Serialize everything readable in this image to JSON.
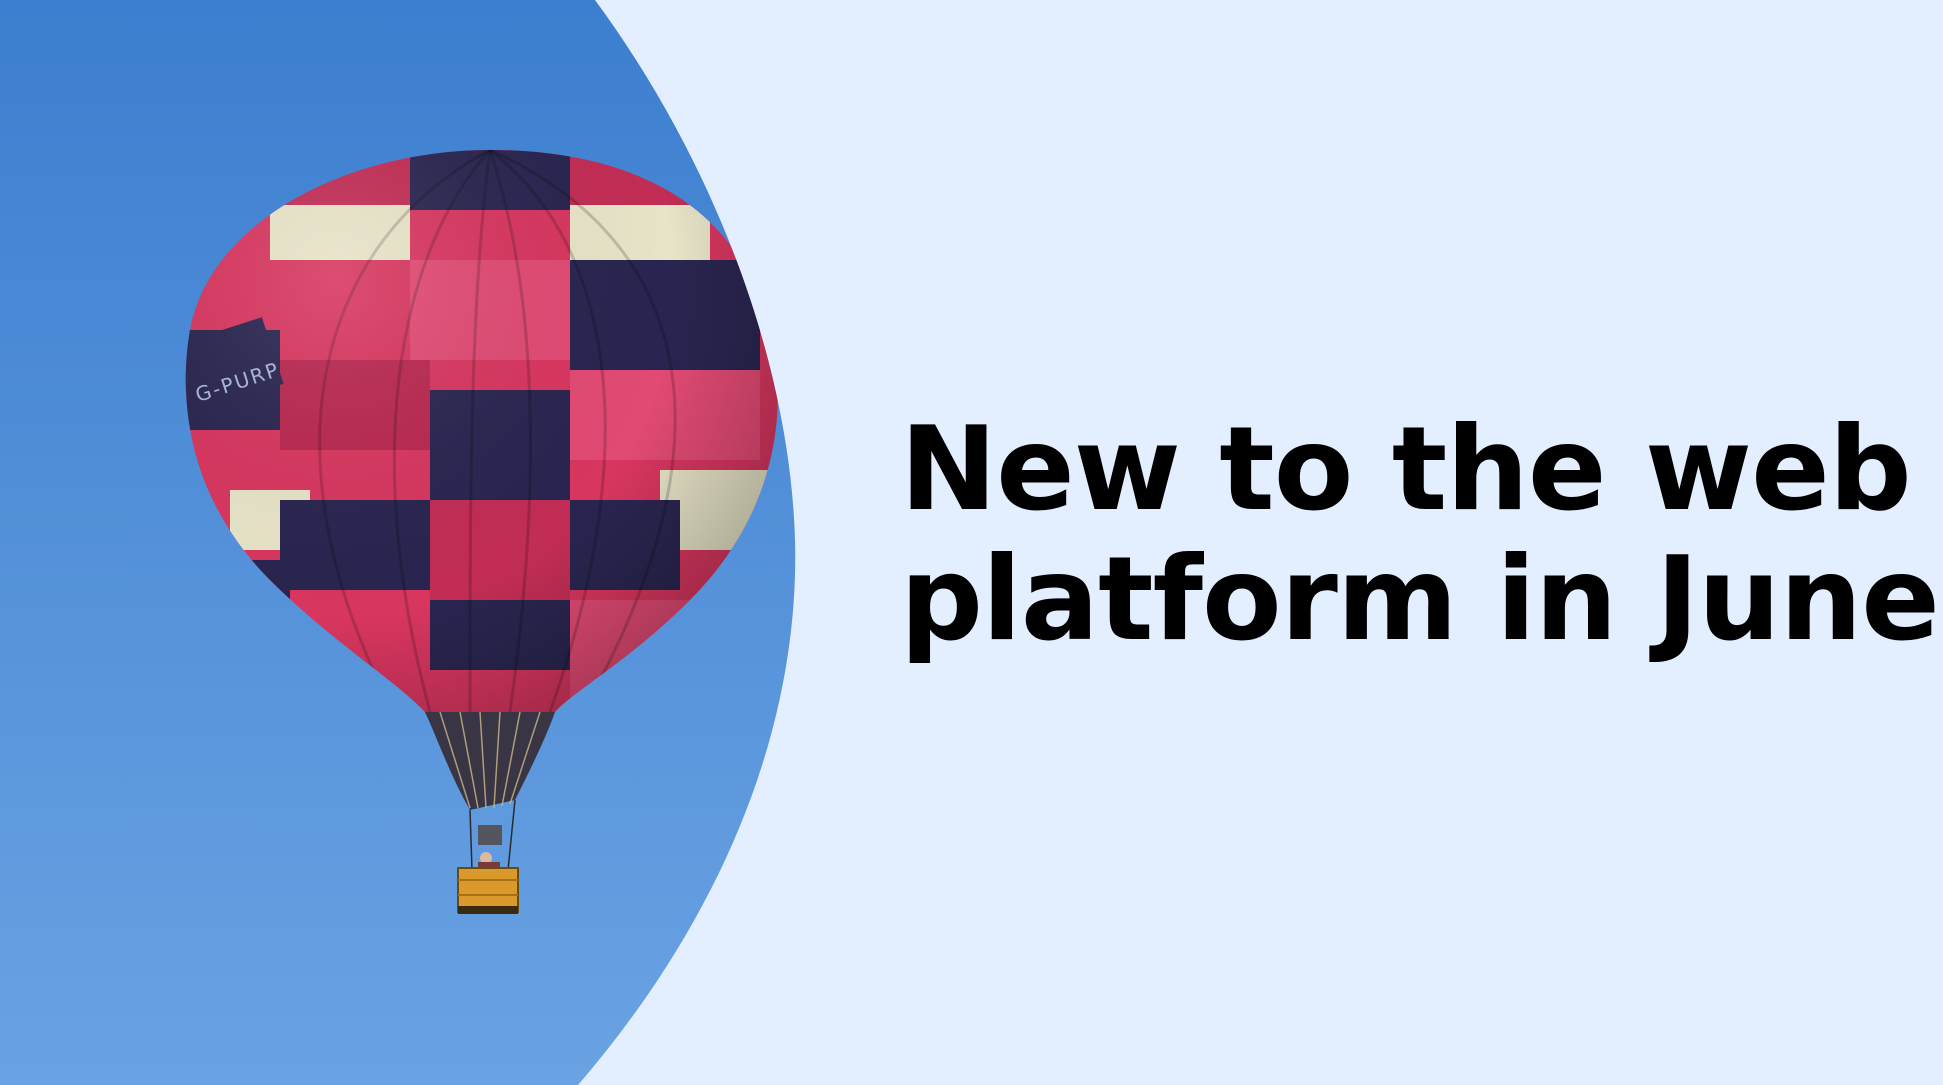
{
  "headline": {
    "line1": "New to the web",
    "line2": "platform in June"
  },
  "balloon": {
    "registration": "G-PURP"
  },
  "colors": {
    "background": "#e3eefe",
    "sky_top": "#3c7ecf",
    "sky_bottom": "#6aa3e3",
    "balloon_pink": "#d8365f",
    "balloon_navy": "#2a2550",
    "balloon_cream": "#e8e4c8",
    "basket": "#d99a2b"
  }
}
